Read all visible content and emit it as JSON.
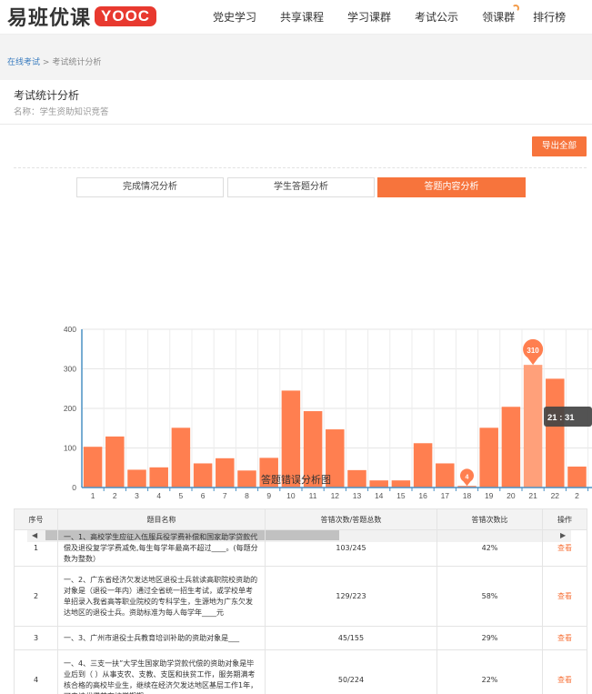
{
  "logo": {
    "text": "易班优课",
    "badge": "YOOC"
  },
  "nav": [
    {
      "label": "党史学习"
    },
    {
      "label": "共享课程"
    },
    {
      "label": "学习课群"
    },
    {
      "label": "考试公示"
    },
    {
      "label": "领课群"
    },
    {
      "label": "排行榜"
    }
  ],
  "breadcrumb": {
    "home": "在线考试",
    "sep": ">",
    "current": "考试统计分析"
  },
  "page": {
    "title": "考试统计分析",
    "subtitle": "名称：学生资助知识竞答"
  },
  "export_label": "导出全部",
  "tabs": [
    {
      "label": "完成情况分析",
      "active": false
    },
    {
      "label": "学生答题分析",
      "active": false
    },
    {
      "label": "答题内容分析",
      "active": true
    }
  ],
  "chart_data": {
    "type": "bar",
    "title": "答题错误分析图",
    "ylim": [
      0,
      400
    ],
    "yticks": [
      "0",
      "100",
      "200",
      "300",
      "400"
    ],
    "categories": [
      "1",
      "2",
      "3",
      "4",
      "5",
      "6",
      "7",
      "8",
      "9",
      "10",
      "11",
      "12",
      "13",
      "14",
      "15",
      "16",
      "17",
      "18",
      "19",
      "20",
      "21",
      "22",
      "2"
    ],
    "values": [
      103,
      129,
      45,
      51,
      151,
      61,
      74,
      43,
      75,
      245,
      193,
      147,
      44,
      18,
      18,
      112,
      61,
      4,
      151,
      204,
      310,
      275,
      53
    ],
    "highlight_index": 20,
    "highlight_label": "310",
    "min_marker_index": 17,
    "min_marker_label": "4",
    "tooltip": "21 : 31",
    "colors": {
      "bar": "#ff7f50",
      "highlight": "#ffa07a",
      "axis": "#4a90c4"
    }
  },
  "scroll": {
    "left_arrow": "◀",
    "right_arrow": "▶"
  },
  "table": {
    "headers": [
      "序号",
      "题目名称",
      "答错次数/答题总数",
      "答错次数比",
      "操作"
    ],
    "rows": [
      {
        "no": "1",
        "name": "一、1、高校学生应征入伍服兵役学费补偿和国家助学贷款代偿及退役复学学费减免,每生每学年最高不超过____。(每题分数为整数）",
        "ratio": "103/245",
        "pct": "42%",
        "op": "查看"
      },
      {
        "no": "2",
        "name": "一、2、广东省经济欠发达地区退役士兵就读高职院校资助的对象是（退役一年内）通过全省统一招生考试，或学校单考单招录入我省高等职业院校的专科学生，生源地为广东欠发达地区的退役士兵。资助标准为每人每学年____元",
        "ratio": "129/223",
        "pct": "58%",
        "op": "查看"
      },
      {
        "no": "3",
        "name": "一、3、广州市退役士兵教育培训补助的资助对象是___",
        "ratio": "45/155",
        "pct": "29%",
        "op": "查看"
      },
      {
        "no": "4",
        "name": "一、4、三支一扶”大学生国家助学贷款代偿的资助对象是毕业后到（ ）从事支农、支教、支医和扶贫工作，服务期满考核合格的高校毕业生，继续在经济欠发达地区基层工作1年，可申请代偿其在校学期期",
        "ratio": "50/224",
        "pct": "22%",
        "op": "查看"
      }
    ]
  }
}
